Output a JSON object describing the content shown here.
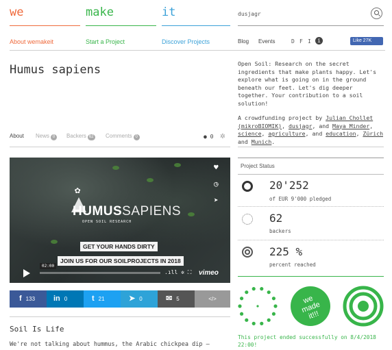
{
  "brand": {
    "we": "we",
    "make": "make",
    "it": "it",
    "colors": {
      "we": "#ef6a3c",
      "make": "#38b54a",
      "it": "#3aa1d8"
    }
  },
  "nav": {
    "about": "About wemakeit",
    "start": "Start a Project",
    "discover": "Discover Projects"
  },
  "search": {
    "value": "dusjagr",
    "icon": "search-icon"
  },
  "utility": {
    "blog": "Blog",
    "events": "Events",
    "lang_d": "D",
    "lang_f": "F",
    "lang_i": "I",
    "info": "i",
    "fb_like": "Like 27K"
  },
  "project": {
    "title": "Humus sapiens",
    "description": "Open Soil: Research on the secret ingredients that make plants happy. Let's explore what is going on in the ground beneath our feet. Let's dig deeper together. Your contribution to a soil solution!",
    "byline_prefix": "A crowdfunding project by ",
    "author1": "Julian Chollet (mikroBIOMIK)",
    "sep1": ", ",
    "author2": "dusjagr",
    "sep2": ", and ",
    "author3": "Maya Minder",
    "sep3": ", ",
    "cat1": "science",
    "sep4": ", ",
    "cat2": "agriculture",
    "sep5": ", and ",
    "cat3": "education",
    "sep6": ", ",
    "loc1": "Zürich",
    "sep7": " and ",
    "loc2": "Munich",
    "end": "."
  },
  "tabs": {
    "about": "About",
    "news": "News",
    "news_count": "0",
    "backers": "Backers",
    "backers_count": "62",
    "comments": "Comments",
    "comments_count": "0",
    "menu_count": "0"
  },
  "video": {
    "logo_bold": "HUMUS",
    "logo_thin": "SAPIENS",
    "logo_sub": "OPEN SOIL RESEARCH",
    "banner1": "GET YOUR HANDS DIRTY",
    "banner2": "JOIN US FOR OUR SOILPROJECTS IN 2018",
    "time": "02:00",
    "brand": "vimeo"
  },
  "share": {
    "facebook": "f",
    "facebook_count": "133",
    "linkedin": "in",
    "linkedin_count": "0",
    "twitter": "t",
    "twitter_count": "21",
    "telegram": "➤",
    "telegram_count": "0",
    "email": "✉",
    "email_count": "5",
    "embed": "</>",
    "colors": {
      "facebook": "#3b5998",
      "linkedin": "#0077b5",
      "twitter": "#1da1f2",
      "telegram": "#2ea3d8",
      "email": "#555555",
      "embed": "#999999"
    }
  },
  "content": {
    "section_title": "Soil Is Life",
    "section_text": "We're not talking about hummus, the Arabic chickpea dip –"
  },
  "status": {
    "heading": "Project Status",
    "pledged": "20'252",
    "pledged_label": "of EUR 9'000 pledged",
    "backers": "62",
    "backers_label": "backers",
    "percent": "225 %",
    "percent_label": "percent reached",
    "badge_text": "we made it!!!",
    "ended": "This project ended successfully on 8/4/2018 22:00!"
  }
}
